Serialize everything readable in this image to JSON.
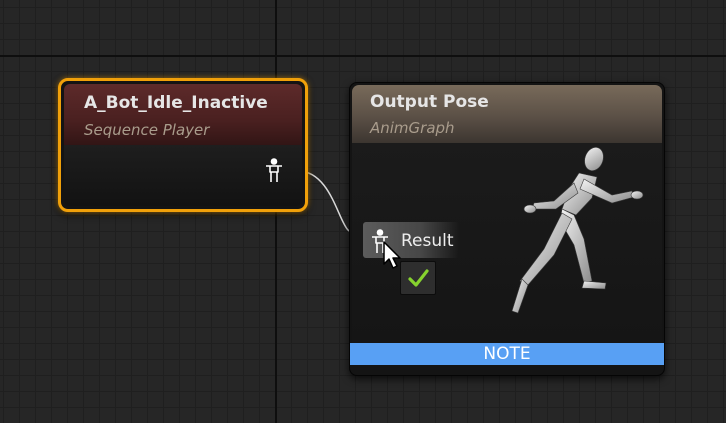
{
  "sequence_node": {
    "title": "A_Bot_Idle_Inactive",
    "subtitle": "Sequence Player",
    "output_pin_icon": "pose-pin-icon"
  },
  "output_node": {
    "title": "Output Pose",
    "subtitle": "AnimGraph",
    "input_pin_icon": "pose-pin-icon",
    "input_pin_label": "Result",
    "preview_icon": "mannequin-running-preview",
    "note_label": "NOTE"
  },
  "colors": {
    "selection_border": "#f0a00a",
    "sequence_header": "#5d2a2a",
    "output_header": "#786a5a",
    "note_bar": "#58a0f4",
    "check": "#86d22e"
  }
}
